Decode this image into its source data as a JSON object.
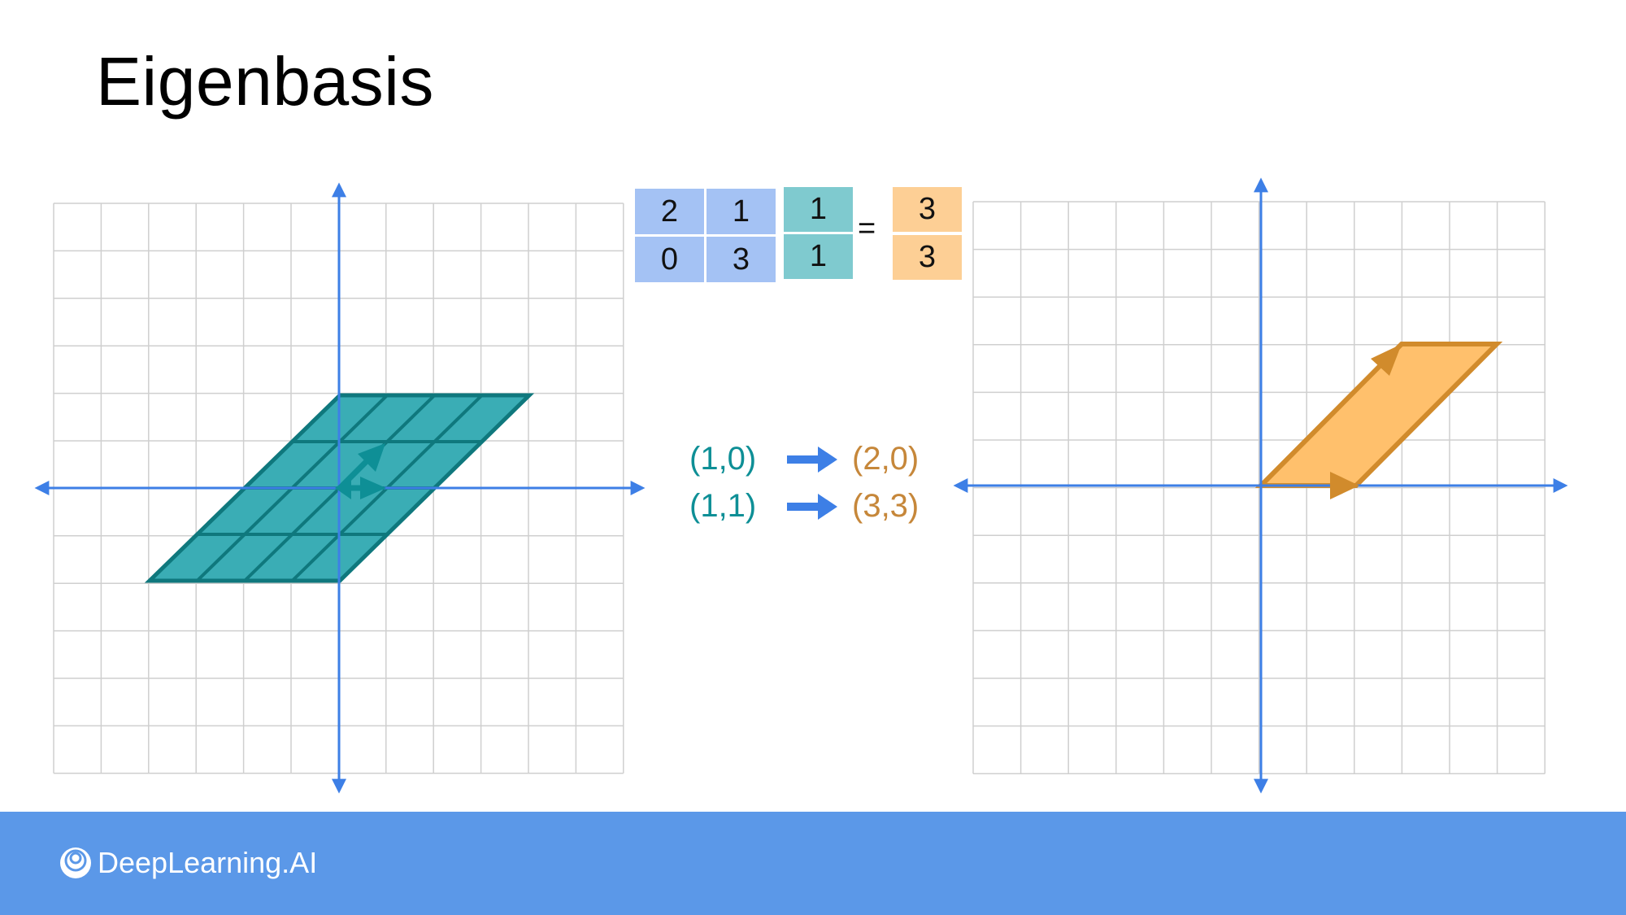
{
  "slide": {
    "title": "Eigenbasis"
  },
  "matrix": {
    "cells": [
      "2",
      "1",
      "0",
      "3"
    ]
  },
  "vector": {
    "cells": [
      "1",
      "1"
    ]
  },
  "result": {
    "cells": [
      "3",
      "3"
    ]
  },
  "equals": "=",
  "mappings": [
    {
      "from": "(1,0)",
      "to": "(2,0)"
    },
    {
      "from": "(1,1)",
      "to": "(3,3)"
    }
  ],
  "footer": {
    "brand": "DeepLearning.AI"
  },
  "colors": {
    "axis": "#3d7fe6",
    "grid": "#cfcfcf",
    "teal_fill": "#3aadb5",
    "teal_stroke": "#0f787d",
    "teal_arrow": "#0e8f96",
    "orange_fill": "#ffc06c",
    "orange_stroke": "#d18b2c",
    "matrix_blue": "#a4c2f4",
    "vector_teal": "#7fcacf",
    "result_orange": "#fdcf95",
    "footer_blue": "#5b98e8"
  }
}
